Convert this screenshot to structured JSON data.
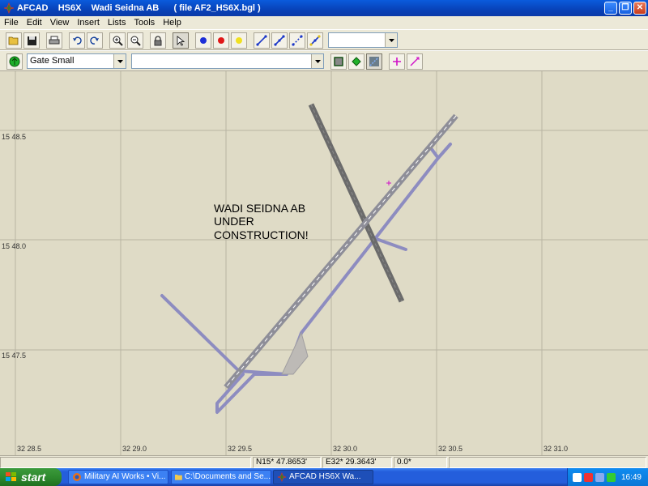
{
  "window": {
    "title": "AFCAD    HS6X    Wadi Seidna AB      ( file AF2_HS6X.bgl )"
  },
  "menu": [
    "File",
    "Edit",
    "View",
    "Insert",
    "Lists",
    "Tools",
    "Help"
  ],
  "toolbar2": {
    "object_type": "Gate Small",
    "second_combo": ""
  },
  "map": {
    "annotation": [
      "WADI SEIDNA AB",
      "UNDER",
      "CONSTRUCTION!"
    ],
    "lat_labels": [
      "15 48.5",
      "15 48.0",
      "15 47.5"
    ],
    "lon_labels": [
      "32 28.5",
      "32 29.0",
      "32 29.5",
      "32 30.0",
      "32 30.5",
      "32 31.0"
    ],
    "colors": {
      "background": "#dfdbc6",
      "grid": "#b9b5a3",
      "runway_main": "#8e8e98",
      "runway_cross": "#6b6b6b",
      "taxiway": "#8d8cc0"
    }
  },
  "status": {
    "lat": "N15* 47.8653'",
    "lon": "E32* 29.3643'",
    "heading": "0.0*"
  },
  "taskbar": {
    "start": "start",
    "tasks": [
      "Military AI Works • Vi...",
      "C:\\Documents and Se...",
      "AFCAD    HS6X    Wa..."
    ],
    "clock": "16:49"
  }
}
